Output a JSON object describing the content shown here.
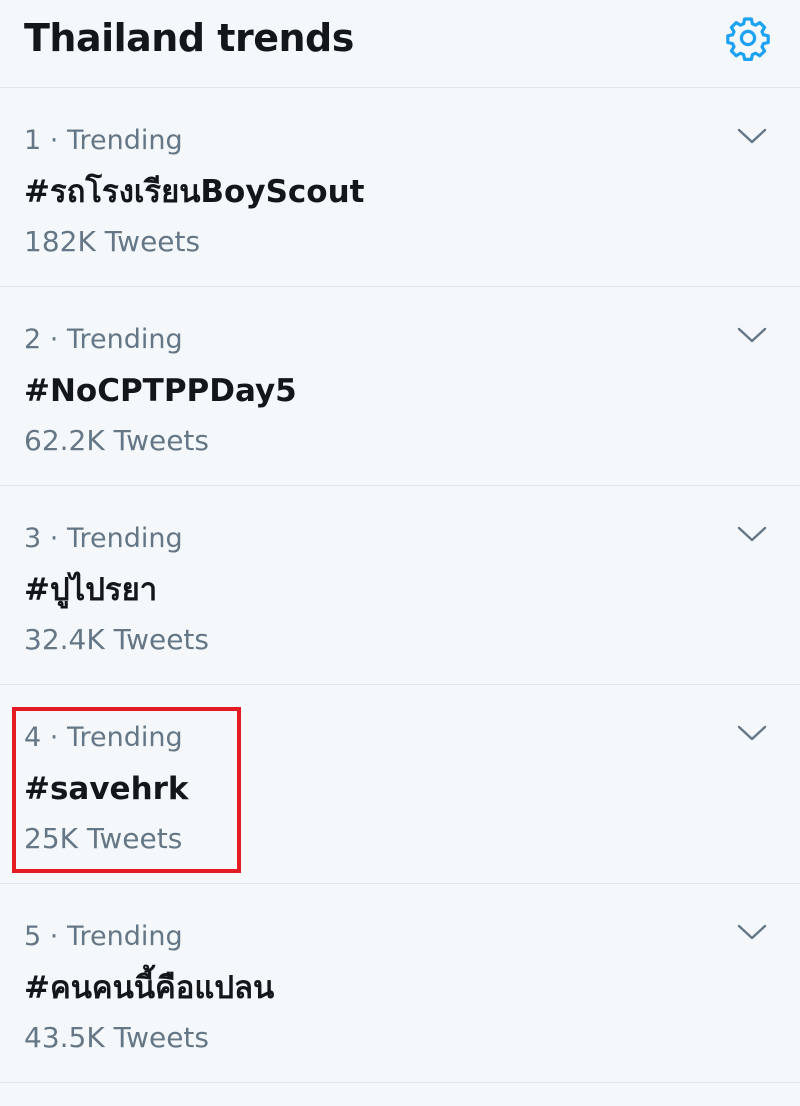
{
  "header": {
    "title": "Thailand trends",
    "settings_icon": "gear-icon",
    "accent_color": "#1da1f2"
  },
  "trends": [
    {
      "rank": "1",
      "separator": "·",
      "label": "Trending",
      "name": "#รถโรงเรียนBoyScout",
      "count": "182K Tweets",
      "menu_icon": "chevron-down-icon"
    },
    {
      "rank": "2",
      "separator": "·",
      "label": "Trending",
      "name": "#NoCPTPPDay5",
      "count": "62.2K Tweets",
      "menu_icon": "chevron-down-icon"
    },
    {
      "rank": "3",
      "separator": "·",
      "label": "Trending",
      "name": "#ปูไปรยา",
      "count": "32.4K Tweets",
      "menu_icon": "chevron-down-icon"
    },
    {
      "rank": "4",
      "separator": "·",
      "label": "Trending",
      "name": "#savehrk",
      "count": "25K Tweets",
      "menu_icon": "chevron-down-icon"
    },
    {
      "rank": "5",
      "separator": "·",
      "label": "Trending",
      "name": "#คนคนนี้คือแปลน",
      "count": "43.5K Tweets",
      "menu_icon": "chevron-down-icon"
    }
  ],
  "annotation": {
    "highlight_color": "#e31b23",
    "highlighted_trend_rank": "4"
  }
}
